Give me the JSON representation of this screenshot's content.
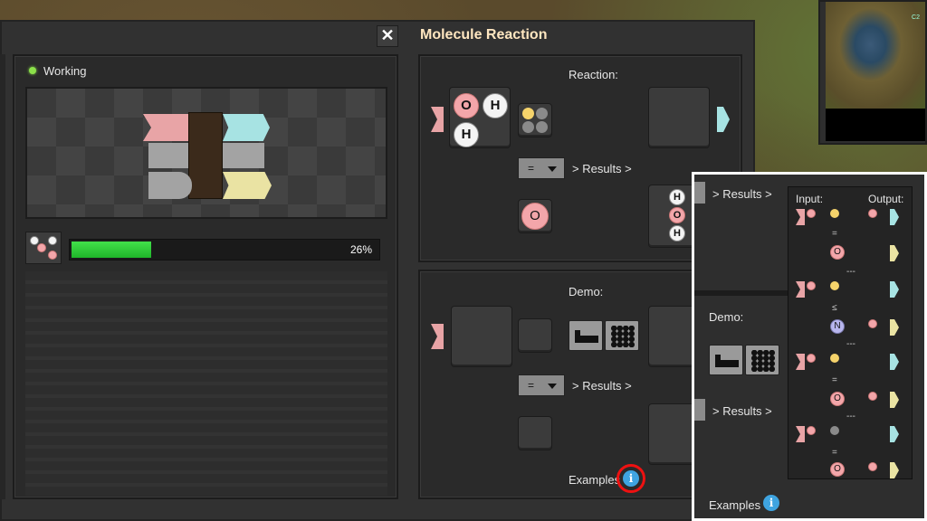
{
  "window": {
    "title": "Molecule Reaction",
    "close_glyph": "✕"
  },
  "status": {
    "label": "Working",
    "color": "#8be04a"
  },
  "progress": {
    "value": 0.26,
    "text": "26%"
  },
  "reaction": {
    "label": "Reaction:",
    "results_label": "> Results >",
    "comparator": "=",
    "input_molecule": {
      "atoms": [
        "O",
        "H",
        "H"
      ]
    },
    "result_atom": "O",
    "output_molecule": {
      "atoms": [
        "H",
        "O",
        "H"
      ]
    }
  },
  "demo": {
    "label": "Demo:",
    "results_label": "> Results >",
    "comparator": "="
  },
  "examples": {
    "label": "Examples",
    "info_glyph": "i"
  },
  "popup": {
    "results_label": "> Results >",
    "demo_label": "Demo:",
    "results_label_2": "> Results >",
    "examples_label": "Examples",
    "info_glyph": "i",
    "tooltip": {
      "input_header": "Input:",
      "output_header": "Output:",
      "rows": [
        {
          "comparator": "=",
          "result_atom": "O"
        },
        {
          "separator": "---",
          "comparator": "≤",
          "result_atom": "N"
        },
        {
          "separator": "---",
          "comparator": "=",
          "result_atom": "O"
        },
        {
          "separator": "---",
          "comparator": "=",
          "result_atom": "O"
        }
      ]
    }
  },
  "minimap": {
    "label": "C2"
  },
  "colors": {
    "accent_green": "#2fd13a",
    "oxygen": "#f3a6aa",
    "hydrogen": "#f4f4f4",
    "nitrogen": "#b8b6ee",
    "belt_pink": "#e8a4a6",
    "belt_cyan": "#a7e3e3",
    "belt_yellow": "#eae3a3",
    "highlight": "#e11111"
  }
}
